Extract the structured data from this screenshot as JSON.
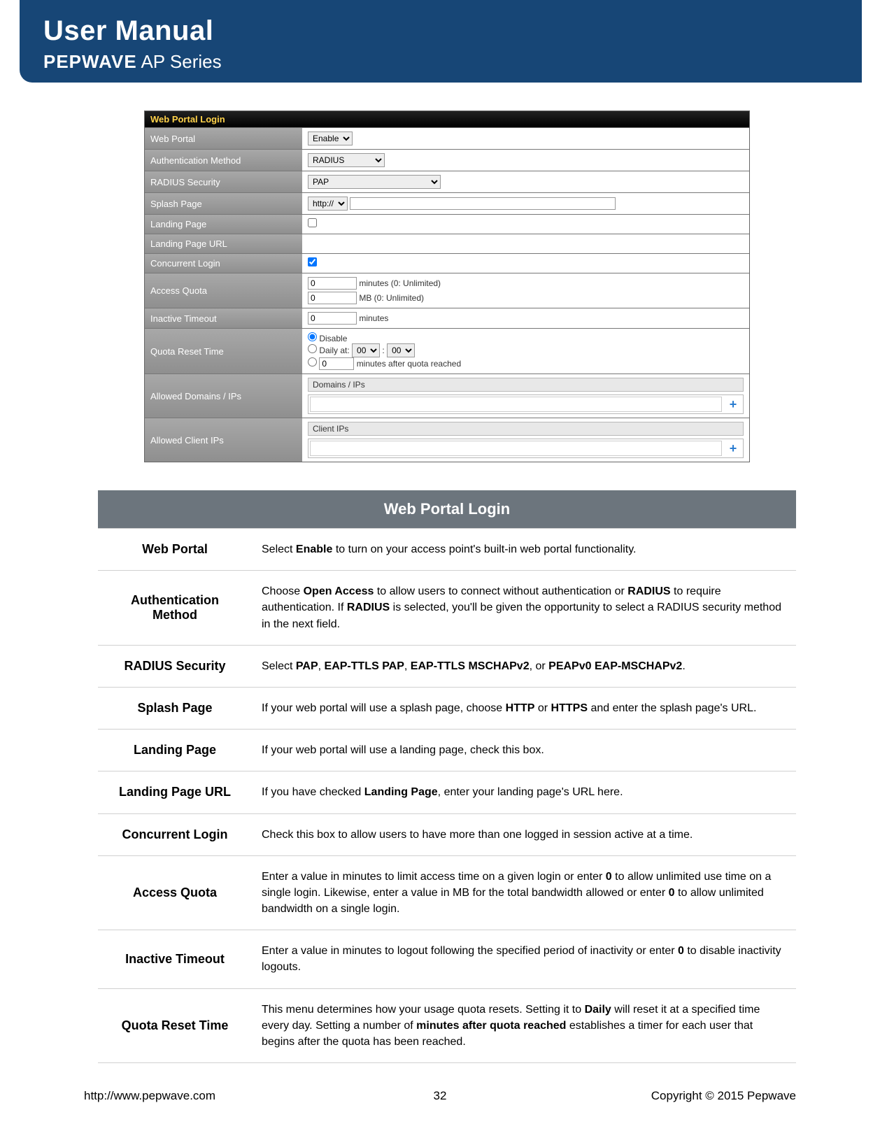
{
  "header": {
    "title": "User Manual",
    "brand": "PEPWAVE",
    "series": "AP Series"
  },
  "config": {
    "title": "Web Portal Login",
    "rows": {
      "web_portal": {
        "label": "Web Portal",
        "value": "Enable"
      },
      "auth_method": {
        "label": "Authentication Method",
        "value": "RADIUS"
      },
      "radius_security": {
        "label": "RADIUS Security",
        "value": "PAP"
      },
      "splash_page": {
        "label": "Splash Page",
        "value": "http://"
      },
      "landing_page": {
        "label": "Landing Page",
        "checked": false
      },
      "landing_page_url": {
        "label": "Landing Page URL",
        "value": ""
      },
      "concurrent_login": {
        "label": "Concurrent Login",
        "checked": true
      },
      "access_quota": {
        "label": "Access Quota",
        "minutes_value": "0",
        "minutes_suffix": "minutes (0: Unlimited)",
        "mb_value": "0",
        "mb_suffix": "MB (0: Unlimited)"
      },
      "inactive_timeout": {
        "label": "Inactive Timeout",
        "value": "0",
        "suffix": "minutes"
      },
      "quota_reset": {
        "label": "Quota Reset Time",
        "disable_label": "Disable",
        "daily_label": "Daily at:",
        "daily_hour": "00",
        "daily_min": "00",
        "after_value": "0",
        "after_suffix": "minutes after quota reached"
      },
      "allowed_domains": {
        "label": "Allowed Domains / IPs",
        "header": "Domains / IPs"
      },
      "allowed_clients": {
        "label": "Allowed Client IPs",
        "header": "Client IPs"
      }
    }
  },
  "desc": {
    "title": "Web Portal Login",
    "rows": [
      {
        "label": "Web Portal",
        "text": "Select <b>Enable</b> to turn on your access point's built-in web portal functionality."
      },
      {
        "label": "Authentication Method",
        "text": "Choose <b>Open Access</b> to allow users to connect without authentication or <b>RADIUS</b> to require authentication. If <b>RADIUS</b> is selected, you'll be given the opportunity to select a RADIUS security method in the next field."
      },
      {
        "label": "RADIUS Security",
        "text": "Select <b>PAP</b>, <b>EAP-TTLS PAP</b>, <b>EAP-TTLS MSCHAPv2</b>, or <b>PEAPv0 EAP-MSCHAPv2</b>."
      },
      {
        "label": "Splash Page",
        "text": "If your web portal will use a splash page, choose <b>HTTP</b> or <b>HTTPS</b> and enter the splash page's URL."
      },
      {
        "label": "Landing Page",
        "text": "If your web portal will use a landing page, check this box."
      },
      {
        "label": "Landing Page URL",
        "text": "If you have checked <b>Landing Page</b>, enter your landing page's URL here."
      },
      {
        "label": "Concurrent Login",
        "text": "Check this box to allow users to have more than one logged in session active at a time."
      },
      {
        "label": "Access Quota",
        "text": "Enter a value in minutes to limit access time on a given login or enter <b>0</b> to allow unlimited use time on a single login. Likewise, enter a value in MB for the total bandwidth allowed or enter <b>0</b> to allow unlimited bandwidth on a single login."
      },
      {
        "label": "Inactive Timeout",
        "text": "Enter a value in minutes to logout following the specified period of inactivity or enter <b>0</b> to disable inactivity logouts."
      },
      {
        "label": "Quota Reset Time",
        "text": "This menu determines how your usage quota resets. Setting it to <b>Daily</b> will reset it at a specified time every day. Setting a number of <b>minutes after quota reached</b> establishes a timer for each user that begins after the quota has been reached."
      }
    ]
  },
  "footer": {
    "url": "http://www.pepwave.com",
    "page": "32",
    "copyright": "Copyright  ©  2015  Pepwave"
  }
}
